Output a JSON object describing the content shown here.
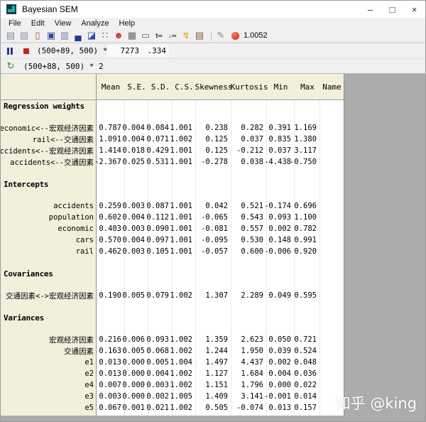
{
  "window": {
    "title": "Bayesian SEM",
    "controls": [
      {
        "name": "minimize-button",
        "glyph": "–"
      },
      {
        "name": "maximize-button",
        "glyph": "□"
      },
      {
        "name": "close-button",
        "glyph": "×"
      }
    ]
  },
  "menu": {
    "items": [
      "File",
      "Edit",
      "View",
      "Analyze",
      "Help"
    ]
  },
  "toolbar": {
    "cs_value": "1.0052",
    "icons": [
      {
        "name": "print-icon",
        "glyph": "▤",
        "color": "#7c8ba0"
      },
      {
        "name": "clipboard-icon",
        "glyph": "▨",
        "color": "#8a97ad"
      },
      {
        "name": "document-icon",
        "glyph": "▯",
        "color": "#b04a3a"
      },
      {
        "name": "save-icon",
        "glyph": "▣",
        "color": "#31479e"
      },
      {
        "name": "copy-icon",
        "glyph": "▥",
        "color": "#6d7fb0"
      },
      {
        "name": "polygon-chart-icon",
        "glyph": "▄",
        "color": "#24368f"
      },
      {
        "name": "histogram-icon",
        "glyph": "◪",
        "color": "#2e4fae"
      },
      {
        "name": "scatterplot-icon",
        "glyph": "∷",
        "color": "#2e4fae"
      },
      {
        "name": "smiley-icon",
        "glyph": "☻",
        "color": "#c0392b"
      },
      {
        "name": "table-icon",
        "glyph": "▦",
        "color": "#5b6770"
      },
      {
        "name": "textbox-icon",
        "glyph": "▭",
        "color": "#5b6770"
      },
      {
        "name": "first-moments-icon",
        "glyph": "t∞",
        "color": "#333333",
        "text": true
      },
      {
        "name": "second-moments-icon",
        "glyph": "↓∞",
        "color": "#333333",
        "text": true
      },
      {
        "name": "lightning-icon",
        "glyph": "↯",
        "color": "#e2a400"
      },
      {
        "name": "pages-icon",
        "glyph": "▤",
        "color": "#7a5c33"
      },
      {
        "name": "separator",
        "separator": true
      },
      {
        "name": "wrench-icon",
        "glyph": "✎",
        "color": "#8a8a8a"
      },
      {
        "name": "convergence-ball-icon",
        "ball": true,
        "color": "#d0271a"
      }
    ]
  },
  "status_rows": [
    {
      "text": "(500+89, 500) * 2",
      "samples": "7273",
      "acceptance": ".334"
    },
    {
      "text": "(500+88, 500) * 2"
    }
  ],
  "table": {
    "columns": [
      "Mean",
      "S.E.",
      "S.D.",
      "C.S.",
      "Skewness",
      "Kurtosis",
      "Min",
      "Max",
      "Name"
    ],
    "groups": [
      {
        "title": "Regression weights",
        "rows": [
          {
            "label": "economic<--宏观经济因素",
            "values": [
              "0.787",
              "0.004",
              "0.084",
              "1.001",
              "0.238",
              "0.282",
              "0.391",
              "1.169",
              ""
            ]
          },
          {
            "label": "rail<--交通因素",
            "values": [
              "1.091",
              "0.004",
              "0.071",
              "1.002",
              "0.125",
              "0.037",
              "0.835",
              "1.380",
              ""
            ]
          },
          {
            "label": "accidents<--宏观经济因素",
            "values": [
              "1.414",
              "0.018",
              "0.429",
              "1.001",
              "0.125",
              "-0.212",
              "0.037",
              "3.117",
              ""
            ]
          },
          {
            "label": "accidents<--交通因素",
            "values": [
              "-2.367",
              "0.025",
              "0.531",
              "1.001",
              "-0.278",
              "0.038",
              "-4.438",
              "-0.750",
              ""
            ]
          }
        ]
      },
      {
        "title": "Intercepts",
        "rows": [
          {
            "label": "accidents",
            "values": [
              "0.259",
              "0.003",
              "0.087",
              "1.001",
              "0.042",
              "0.521",
              "-0.174",
              "0.696",
              ""
            ]
          },
          {
            "label": "population",
            "values": [
              "0.602",
              "0.004",
              "0.112",
              "1.001",
              "-0.065",
              "0.543",
              "0.093",
              "1.100",
              ""
            ]
          },
          {
            "label": "economic",
            "values": [
              "0.403",
              "0.003",
              "0.090",
              "1.001",
              "-0.081",
              "0.557",
              "0.002",
              "0.782",
              ""
            ]
          },
          {
            "label": "cars",
            "values": [
              "0.570",
              "0.004",
              "0.097",
              "1.001",
              "-0.095",
              "0.530",
              "0.148",
              "0.991",
              ""
            ]
          },
          {
            "label": "rail",
            "values": [
              "0.462",
              "0.003",
              "0.105",
              "1.001",
              "-0.057",
              "0.600",
              "-0.006",
              "0.920",
              ""
            ]
          }
        ]
      },
      {
        "title": "Covariances",
        "rows": [
          {
            "label": "交通因素<->宏观经济因素",
            "values": [
              "0.190",
              "0.005",
              "0.079",
              "1.002",
              "1.307",
              "2.289",
              "0.049",
              "0.595",
              ""
            ]
          }
        ]
      },
      {
        "title": "Variances",
        "rows": [
          {
            "label": "宏观经济因素",
            "values": [
              "0.216",
              "0.006",
              "0.093",
              "1.002",
              "1.359",
              "2.623",
              "0.050",
              "0.721",
              ""
            ]
          },
          {
            "label": "交通因素",
            "values": [
              "0.163",
              "0.005",
              "0.068",
              "1.002",
              "1.244",
              "1.950",
              "0.039",
              "0.524",
              ""
            ]
          },
          {
            "label": "e1",
            "values": [
              "0.013",
              "0.000",
              "0.005",
              "1.004",
              "1.497",
              "4.437",
              "0.002",
              "0.048",
              ""
            ]
          },
          {
            "label": "e2",
            "values": [
              "0.013",
              "0.000",
              "0.004",
              "1.002",
              "1.127",
              "1.684",
              "0.004",
              "0.036",
              ""
            ]
          },
          {
            "label": "e4",
            "values": [
              "0.007",
              "0.000",
              "0.003",
              "1.002",
              "1.151",
              "1.796",
              "0.000",
              "0.022",
              ""
            ]
          },
          {
            "label": "e3",
            "values": [
              "0.003",
              "0.000",
              "0.002",
              "1.005",
              "1.409",
              "3.141",
              "-0.001",
              "0.014",
              ""
            ]
          },
          {
            "label": "e5",
            "values": [
              "0.067",
              "0.001",
              "0.021",
              "1.002",
              "0.505",
              "-0.074",
              "0.013",
              "0.157",
              ""
            ]
          }
        ]
      }
    ]
  },
  "watermark": "知乎 @king"
}
